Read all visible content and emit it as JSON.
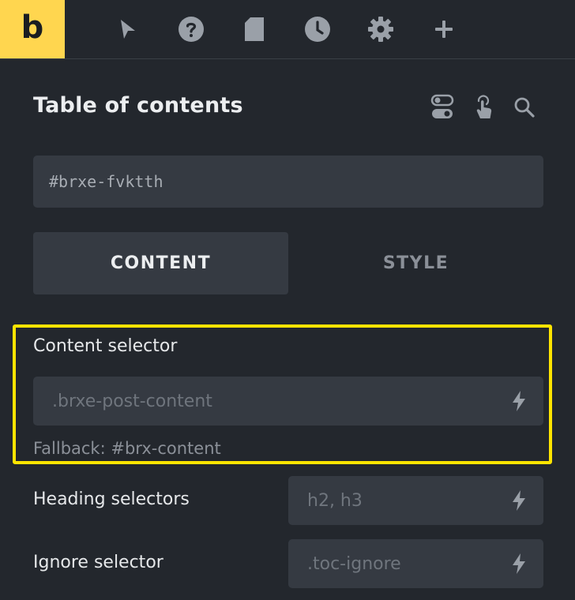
{
  "brand": {
    "logo_text": "b"
  },
  "toolbar": {
    "tools": [
      "cursor-icon",
      "help-icon",
      "page-icon",
      "history-icon",
      "settings-icon",
      "plus-icon"
    ]
  },
  "panel": {
    "title": "Table of contents",
    "header_icons": [
      "toggle-icon",
      "touch-icon",
      "search-icon"
    ],
    "element_id": "#brxe-fvktth",
    "tabs": [
      {
        "label": "CONTENT",
        "active": true
      },
      {
        "label": "STYLE",
        "active": false
      }
    ]
  },
  "settings": {
    "content_selector": {
      "label": "Content selector",
      "placeholder": ".brxe-post-content",
      "hint": "Fallback: #brx-content"
    },
    "heading_selectors": {
      "label": "Heading selectors",
      "placeholder": "h2, h3"
    },
    "ignore_selector": {
      "label": "Ignore selector",
      "placeholder": ".toc-ignore"
    }
  },
  "colors": {
    "brand": "#ffd64f",
    "highlight": "#fde400",
    "background": "#23272d",
    "field": "#353a42"
  }
}
